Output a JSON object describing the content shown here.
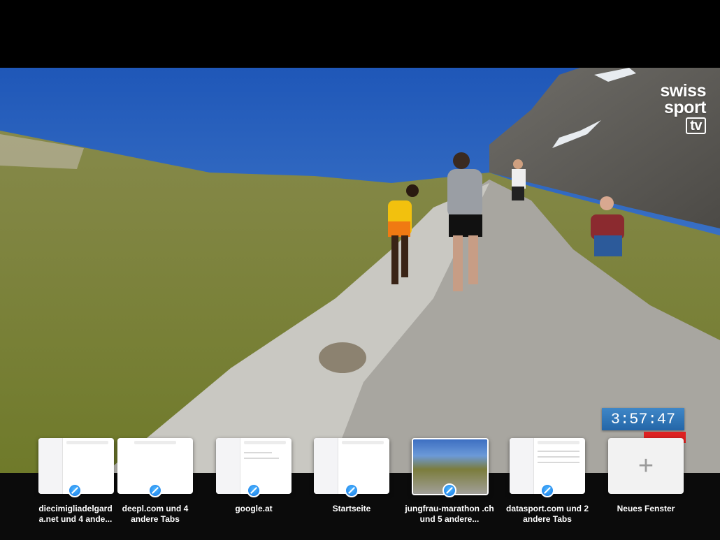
{
  "video": {
    "logo": {
      "line1": "swiss",
      "line2": "sport",
      "line3": "tv"
    },
    "timer": "3:57:47"
  },
  "windows": [
    {
      "label": "diecimigliadelgard a.net und 4 ande...",
      "icon": "safari-icon"
    },
    {
      "label": "deepl.com und 4 andere Tabs",
      "icon": "safari-icon"
    },
    {
      "label": "google.at",
      "icon": "safari-icon"
    },
    {
      "label": "Startseite",
      "icon": "safari-icon"
    },
    {
      "label": "jungfrau-marathon .ch und 5 andere...",
      "icon": "safari-icon"
    },
    {
      "label": "datasport.com und 2 andere Tabs",
      "icon": "safari-icon"
    }
  ],
  "new_window": {
    "label": "Neues Fenster",
    "icon": "plus-icon",
    "glyph": "+"
  },
  "colors": {
    "timer_bg": "#2a70b5",
    "timer_accent": "#d22222",
    "safari_blue": "#1479e6"
  }
}
